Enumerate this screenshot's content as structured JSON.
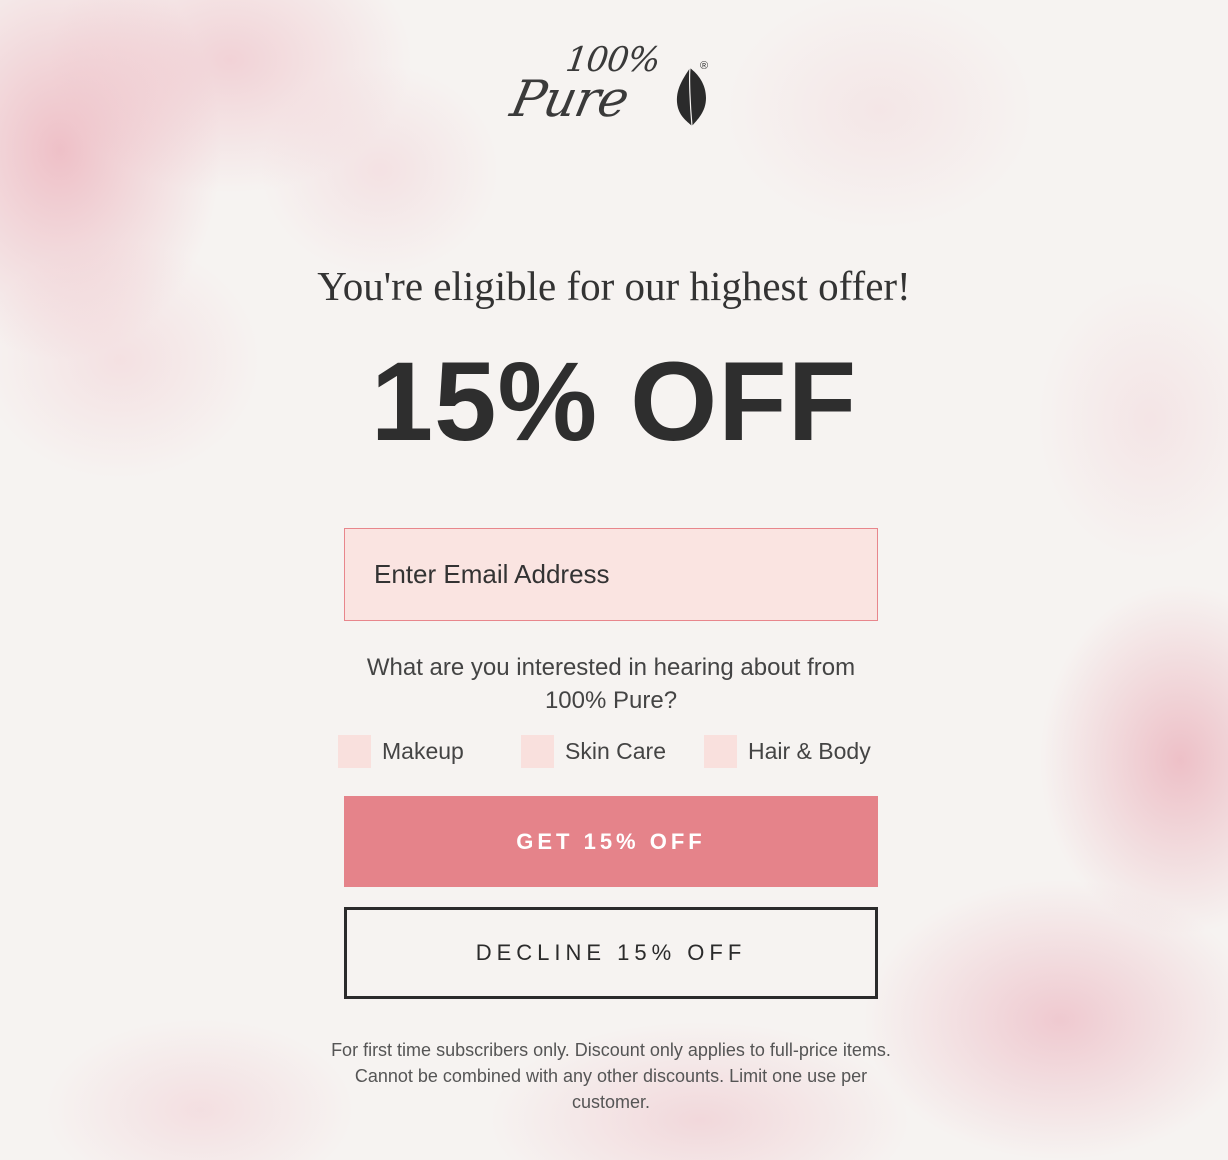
{
  "brand": {
    "logo_top": "100%",
    "logo_script": "Pure",
    "registered_mark": "®"
  },
  "headline": "You're eligible for our highest offer!",
  "offer": "15% OFF",
  "email": {
    "placeholder": "Enter Email Address",
    "value": ""
  },
  "question": "What are you interested in hearing about from 100% Pure?",
  "interests": [
    {
      "label": "Makeup",
      "checked": false
    },
    {
      "label": "Skin Care",
      "checked": false
    },
    {
      "label": "Hair & Body",
      "checked": false
    }
  ],
  "buttons": {
    "accept_label": "GET 15% OFF",
    "decline_label": "DECLINE 15% OFF"
  },
  "disclaimer": "For first time subscribers only. Discount only applies to full-price items. Cannot be combined with any other discounts. Limit one use per customer.",
  "colors": {
    "accent": "#e5838a",
    "input_background": "#fae4e1",
    "input_border": "#e8868c",
    "checkbox_fill": "#f9e0dd",
    "text_dark": "#2e2e2e"
  },
  "icons": {
    "brand_mark": "leaf-icon"
  }
}
